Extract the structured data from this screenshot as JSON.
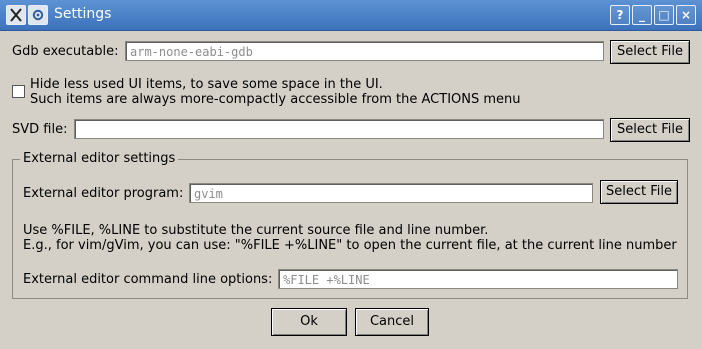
{
  "window": {
    "title": "Settings",
    "icons": {
      "app": "x-logo-icon",
      "menu": "gear-icon"
    },
    "controls": {
      "help": "?",
      "minimize": "_",
      "maximize": "□",
      "close": "×"
    }
  },
  "gdb": {
    "label": "Gdb executable:",
    "placeholder": "arm-none-eabi-gdb",
    "select_label": "Select File"
  },
  "hide_ui": {
    "checked": false,
    "line1": "Hide less used UI items, to save some space in the UI.",
    "line2": "Such items are always more-compactly accessible from the ACTIONS menu"
  },
  "svd": {
    "label": "SVD file:",
    "value": "",
    "select_label": "Select File"
  },
  "external_editor": {
    "group_title": "External editor settings",
    "program_label": "External editor program:",
    "program_placeholder": "gvim",
    "select_label": "Select File",
    "help_line1": "Use %FILE, %LINE to substitute the current source file and line number.",
    "help_line2": "E.g., for vim/gVim, you can use: \"%FILE +%LINE\" to open the current file, at the current line number",
    "cmd_label": "External editor command line options:",
    "cmd_placeholder": "%FILE +%LINE"
  },
  "buttons": {
    "ok": "Ok",
    "cancel": "Cancel"
  }
}
